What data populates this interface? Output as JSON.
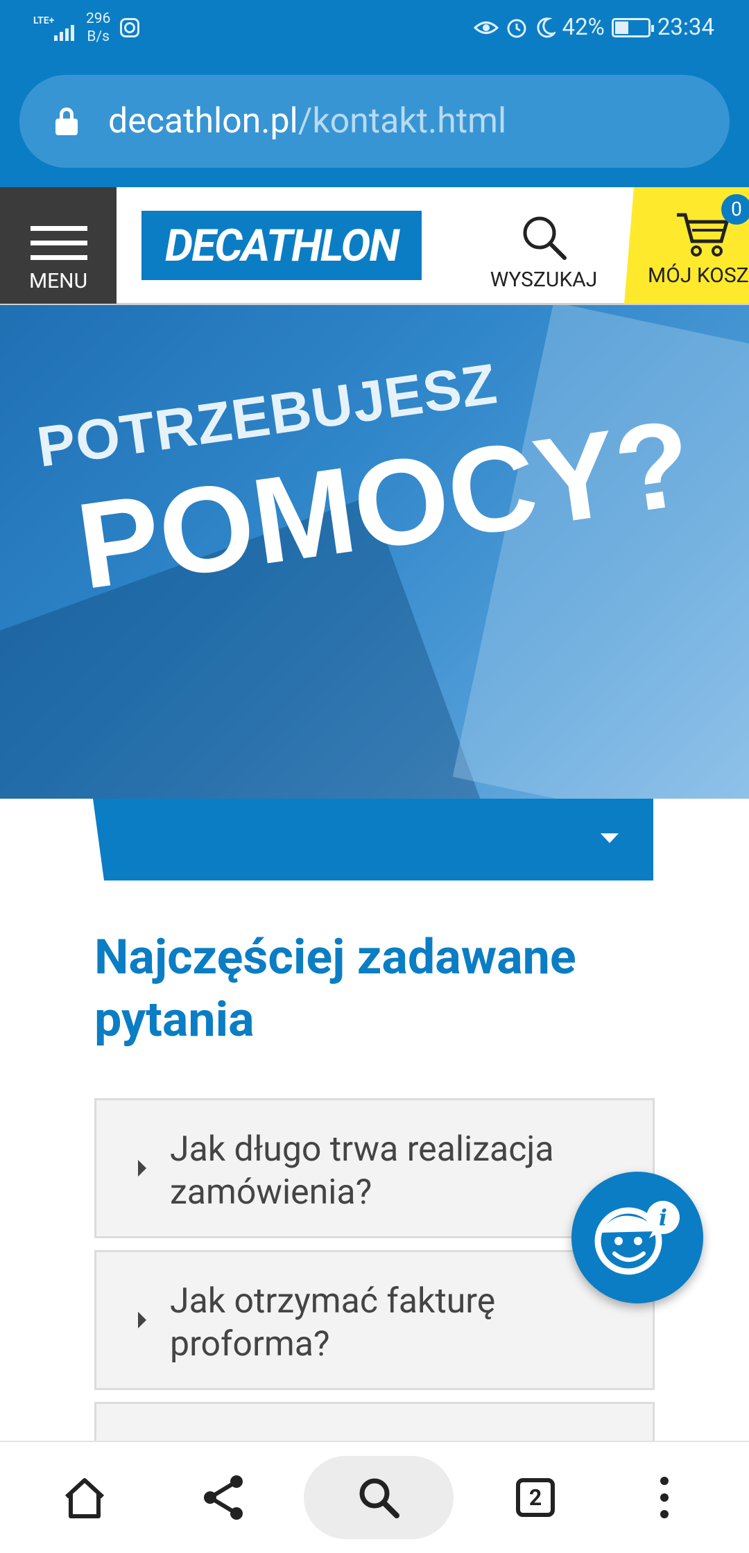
{
  "status_bar": {
    "network": "LTE+",
    "net_speed_value": "296",
    "net_speed_unit": "B/s",
    "battery_percent": "42%",
    "battery_level": 0.42,
    "time": "23:34"
  },
  "browser": {
    "url_host": "decathlon.pl",
    "url_path": "/kontakt.html"
  },
  "header": {
    "menu_label": "MENU",
    "logo_text": "DECATHLON",
    "search_label": "WYSZUKAJ",
    "cart_label": "MÓJ KOSZYK",
    "cart_count": "0"
  },
  "hero": {
    "line1": "POTRZEBUJESZ",
    "line2": "POMOCY?"
  },
  "faq": {
    "title": "Najczęściej zadawane pytania",
    "items": [
      {
        "question": "Jak długo trwa realizacja zamówienia?"
      },
      {
        "question": "Jak otrzymać fakturę proforma?"
      }
    ]
  },
  "colors": {
    "brand_blue": "#0b7dc4",
    "cart_yellow": "#ffe92c",
    "menu_dark": "#3b3b3b"
  },
  "icons": {
    "bottom_nav": [
      "home-icon",
      "share-icon",
      "search-icon",
      "tabs-icon",
      "more-icon"
    ],
    "chat": "chatbot-face-icon"
  },
  "bottom_nav": {
    "tabs_count": "2"
  }
}
